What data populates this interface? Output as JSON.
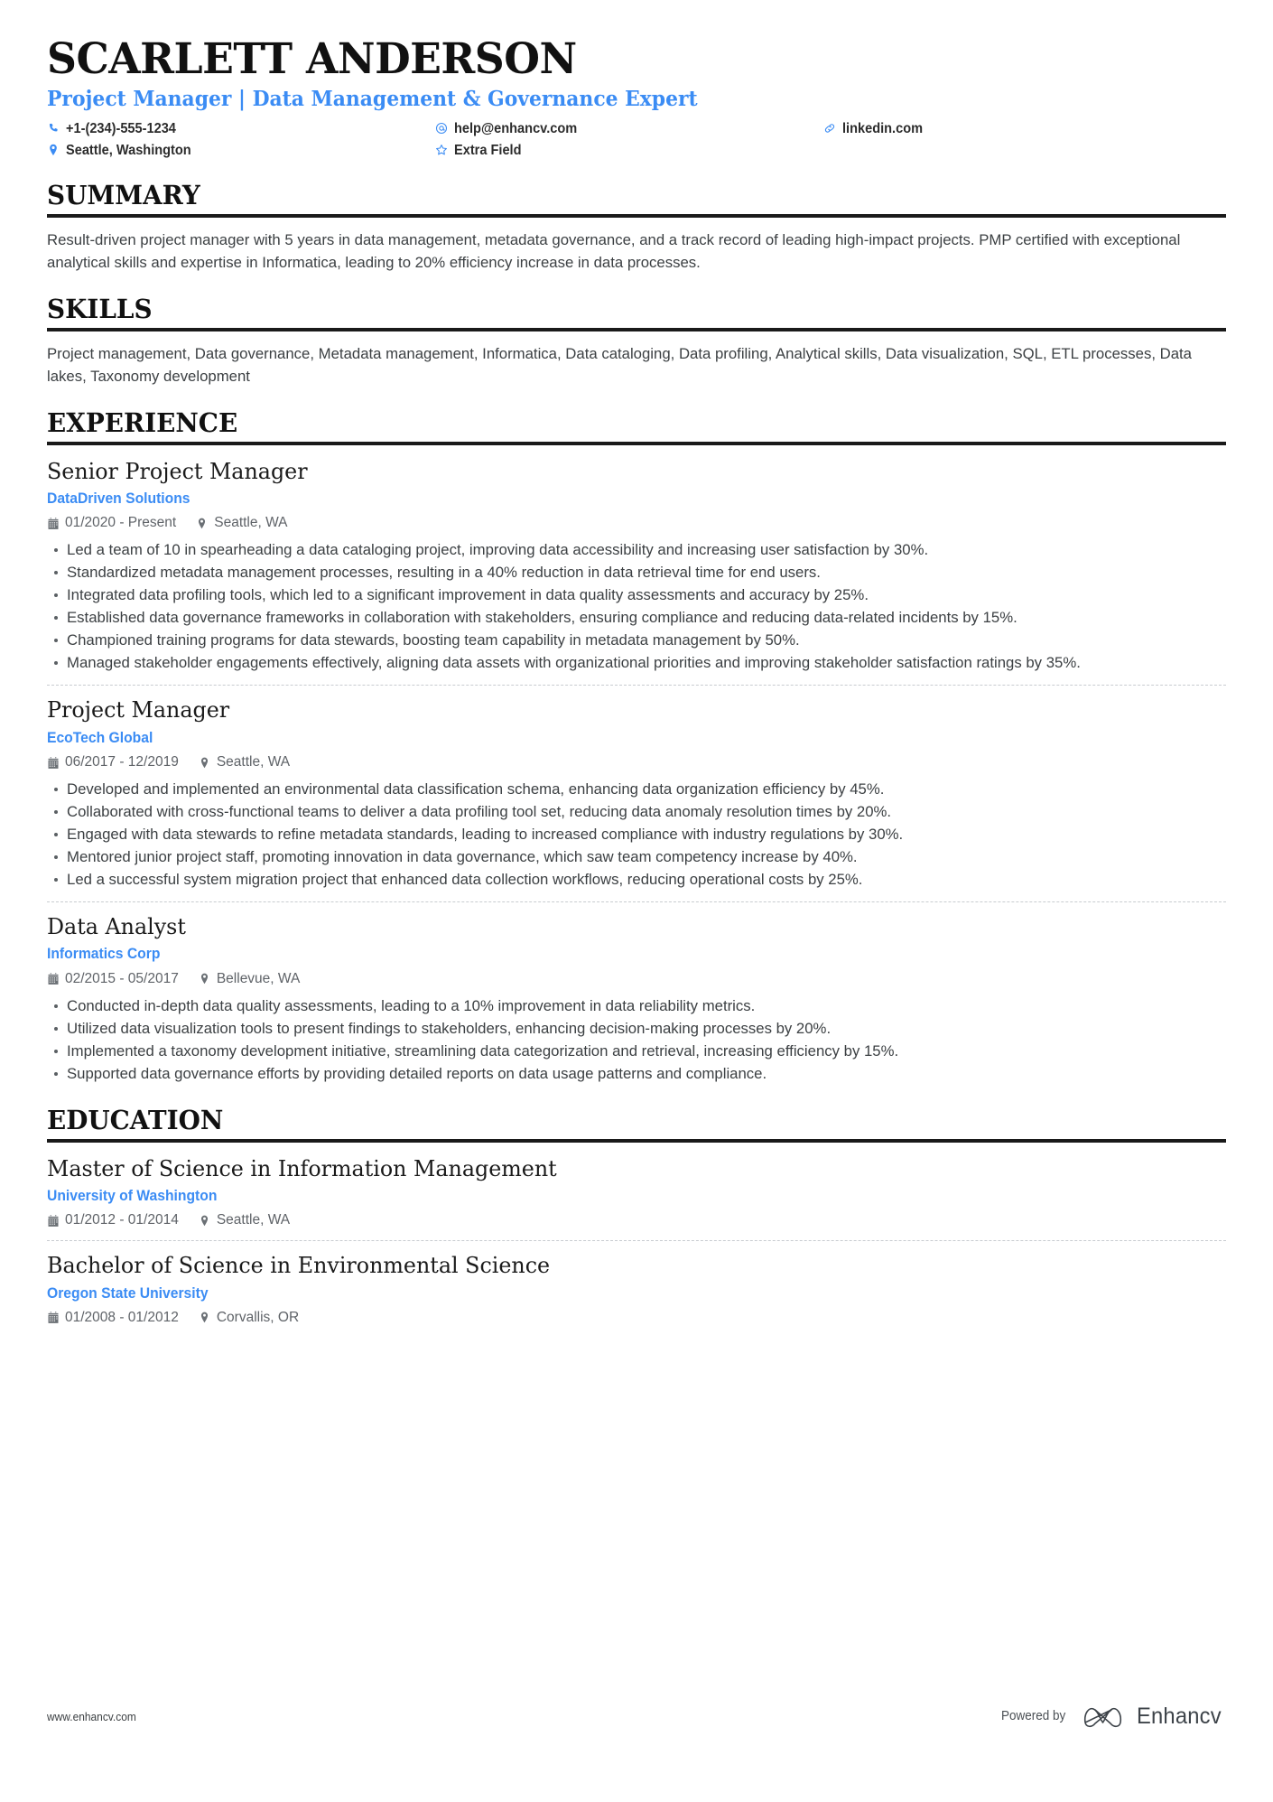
{
  "colors": {
    "accent_blue": "#3b8cf4",
    "heading_black": "#111111",
    "body_gray": "#3c4043",
    "meta_gray": "#5f6368",
    "rule_black": "#1a1a1a",
    "divider_gray": "#c8ccd0"
  },
  "header": {
    "name": "SCARLETT ANDERSON",
    "role": "Project Manager | Data Management & Governance Expert",
    "contacts": [
      {
        "icon": "phone-icon",
        "text": "+1-(234)-555-1234"
      },
      {
        "icon": "email-icon",
        "text": "help@enhancv.com"
      },
      {
        "icon": "link-icon",
        "text": "linkedin.com"
      },
      {
        "icon": "location-icon",
        "text": "Seattle, Washington"
      },
      {
        "icon": "star-icon",
        "text": "Extra Field"
      }
    ]
  },
  "sections": {
    "summary": {
      "heading": "SUMMARY",
      "text": "Result-driven project manager with 5 years in data management, metadata governance, and a track record of leading high-impact projects. PMP certified with exceptional analytical skills and expertise in Informatica, leading to 20% efficiency increase in data processes."
    },
    "skills": {
      "heading": "SKILLS",
      "text": "Project management, Data governance, Metadata management, Informatica, Data cataloging, Data profiling, Analytical skills, Data visualization, SQL, ETL processes, Data lakes, Taxonomy development"
    },
    "experience": {
      "heading": "EXPERIENCE",
      "entries": [
        {
          "title": "Senior Project Manager",
          "organization": "DataDriven Solutions",
          "dates": "01/2020 - Present",
          "location": "Seattle, WA",
          "bullets": [
            "Led a team of 10 in spearheading a data cataloging project, improving data accessibility and increasing user satisfaction by 30%.",
            "Standardized metadata management processes, resulting in a 40% reduction in data retrieval time for end users.",
            "Integrated data profiling tools, which led to a significant improvement in data quality assessments and accuracy by 25%.",
            "Established data governance frameworks in collaboration with stakeholders, ensuring compliance and reducing data-related incidents by 15%.",
            "Championed training programs for data stewards, boosting team capability in metadata management by 50%.",
            "Managed stakeholder engagements effectively, aligning data assets with organizational priorities and improving stakeholder satisfaction ratings by 35%."
          ]
        },
        {
          "title": "Project Manager",
          "organization": "EcoTech Global",
          "dates": "06/2017 - 12/2019",
          "location": "Seattle, WA",
          "bullets": [
            "Developed and implemented an environmental data classification schema, enhancing data organization efficiency by 45%.",
            "Collaborated with cross-functional teams to deliver a data profiling tool set, reducing data anomaly resolution times by 20%.",
            "Engaged with data stewards to refine metadata standards, leading to increased compliance with industry regulations by 30%.",
            "Mentored junior project staff, promoting innovation in data governance, which saw team competency increase by 40%.",
            "Led a successful system migration project that enhanced data collection workflows, reducing operational costs by 25%."
          ]
        },
        {
          "title": "Data Analyst",
          "organization": "Informatics Corp",
          "dates": "02/2015 - 05/2017",
          "location": "Bellevue, WA",
          "bullets": [
            "Conducted in-depth data quality assessments, leading to a 10% improvement in data reliability metrics.",
            "Utilized data visualization tools to present findings to stakeholders, enhancing decision-making processes by 20%.",
            "Implemented a taxonomy development initiative, streamlining data categorization and retrieval, increasing efficiency by 15%.",
            "Supported data governance efforts by providing detailed reports on data usage patterns and compliance."
          ]
        }
      ]
    },
    "education": {
      "heading": "EDUCATION",
      "entries": [
        {
          "title": "Master of Science in Information Management",
          "organization": "University of Washington",
          "dates": "01/2012 - 01/2014",
          "location": "Seattle, WA"
        },
        {
          "title": "Bachelor of Science in Environmental Science",
          "organization": "Oregon State University",
          "dates": "01/2008 - 01/2012",
          "location": "Corvallis, OR"
        }
      ]
    }
  },
  "footer": {
    "url": "www.enhancv.com",
    "powered_by": "Powered by",
    "brand": "Enhancv"
  }
}
